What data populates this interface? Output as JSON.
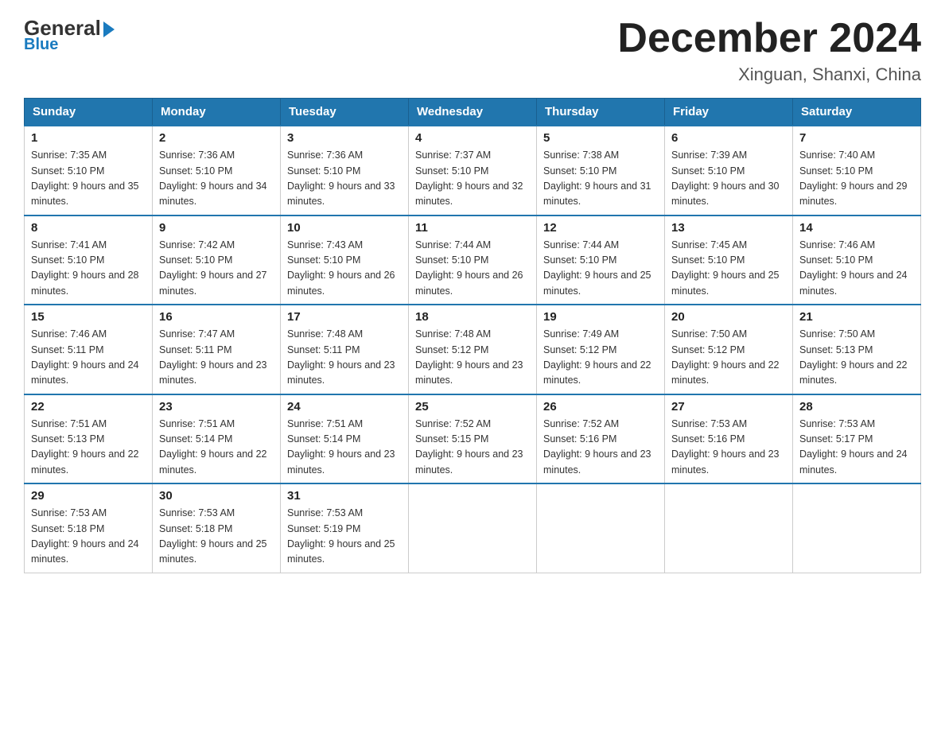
{
  "logo": {
    "general": "General",
    "blue": "Blue"
  },
  "title": "December 2024",
  "location": "Xinguan, Shanxi, China",
  "weekdays": [
    "Sunday",
    "Monday",
    "Tuesday",
    "Wednesday",
    "Thursday",
    "Friday",
    "Saturday"
  ],
  "weeks": [
    [
      {
        "day": "1",
        "sunrise": "7:35 AM",
        "sunset": "5:10 PM",
        "daylight": "9 hours and 35 minutes."
      },
      {
        "day": "2",
        "sunrise": "7:36 AM",
        "sunset": "5:10 PM",
        "daylight": "9 hours and 34 minutes."
      },
      {
        "day": "3",
        "sunrise": "7:36 AM",
        "sunset": "5:10 PM",
        "daylight": "9 hours and 33 minutes."
      },
      {
        "day": "4",
        "sunrise": "7:37 AM",
        "sunset": "5:10 PM",
        "daylight": "9 hours and 32 minutes."
      },
      {
        "day": "5",
        "sunrise": "7:38 AM",
        "sunset": "5:10 PM",
        "daylight": "9 hours and 31 minutes."
      },
      {
        "day": "6",
        "sunrise": "7:39 AM",
        "sunset": "5:10 PM",
        "daylight": "9 hours and 30 minutes."
      },
      {
        "day": "7",
        "sunrise": "7:40 AM",
        "sunset": "5:10 PM",
        "daylight": "9 hours and 29 minutes."
      }
    ],
    [
      {
        "day": "8",
        "sunrise": "7:41 AM",
        "sunset": "5:10 PM",
        "daylight": "9 hours and 28 minutes."
      },
      {
        "day": "9",
        "sunrise": "7:42 AM",
        "sunset": "5:10 PM",
        "daylight": "9 hours and 27 minutes."
      },
      {
        "day": "10",
        "sunrise": "7:43 AM",
        "sunset": "5:10 PM",
        "daylight": "9 hours and 26 minutes."
      },
      {
        "day": "11",
        "sunrise": "7:44 AM",
        "sunset": "5:10 PM",
        "daylight": "9 hours and 26 minutes."
      },
      {
        "day": "12",
        "sunrise": "7:44 AM",
        "sunset": "5:10 PM",
        "daylight": "9 hours and 25 minutes."
      },
      {
        "day": "13",
        "sunrise": "7:45 AM",
        "sunset": "5:10 PM",
        "daylight": "9 hours and 25 minutes."
      },
      {
        "day": "14",
        "sunrise": "7:46 AM",
        "sunset": "5:10 PM",
        "daylight": "9 hours and 24 minutes."
      }
    ],
    [
      {
        "day": "15",
        "sunrise": "7:46 AM",
        "sunset": "5:11 PM",
        "daylight": "9 hours and 24 minutes."
      },
      {
        "day": "16",
        "sunrise": "7:47 AM",
        "sunset": "5:11 PM",
        "daylight": "9 hours and 23 minutes."
      },
      {
        "day": "17",
        "sunrise": "7:48 AM",
        "sunset": "5:11 PM",
        "daylight": "9 hours and 23 minutes."
      },
      {
        "day": "18",
        "sunrise": "7:48 AM",
        "sunset": "5:12 PM",
        "daylight": "9 hours and 23 minutes."
      },
      {
        "day": "19",
        "sunrise": "7:49 AM",
        "sunset": "5:12 PM",
        "daylight": "9 hours and 22 minutes."
      },
      {
        "day": "20",
        "sunrise": "7:50 AM",
        "sunset": "5:12 PM",
        "daylight": "9 hours and 22 minutes."
      },
      {
        "day": "21",
        "sunrise": "7:50 AM",
        "sunset": "5:13 PM",
        "daylight": "9 hours and 22 minutes."
      }
    ],
    [
      {
        "day": "22",
        "sunrise": "7:51 AM",
        "sunset": "5:13 PM",
        "daylight": "9 hours and 22 minutes."
      },
      {
        "day": "23",
        "sunrise": "7:51 AM",
        "sunset": "5:14 PM",
        "daylight": "9 hours and 22 minutes."
      },
      {
        "day": "24",
        "sunrise": "7:51 AM",
        "sunset": "5:14 PM",
        "daylight": "9 hours and 23 minutes."
      },
      {
        "day": "25",
        "sunrise": "7:52 AM",
        "sunset": "5:15 PM",
        "daylight": "9 hours and 23 minutes."
      },
      {
        "day": "26",
        "sunrise": "7:52 AM",
        "sunset": "5:16 PM",
        "daylight": "9 hours and 23 minutes."
      },
      {
        "day": "27",
        "sunrise": "7:53 AM",
        "sunset": "5:16 PM",
        "daylight": "9 hours and 23 minutes."
      },
      {
        "day": "28",
        "sunrise": "7:53 AM",
        "sunset": "5:17 PM",
        "daylight": "9 hours and 24 minutes."
      }
    ],
    [
      {
        "day": "29",
        "sunrise": "7:53 AM",
        "sunset": "5:18 PM",
        "daylight": "9 hours and 24 minutes."
      },
      {
        "day": "30",
        "sunrise": "7:53 AM",
        "sunset": "5:18 PM",
        "daylight": "9 hours and 25 minutes."
      },
      {
        "day": "31",
        "sunrise": "7:53 AM",
        "sunset": "5:19 PM",
        "daylight": "9 hours and 25 minutes."
      },
      null,
      null,
      null,
      null
    ]
  ]
}
